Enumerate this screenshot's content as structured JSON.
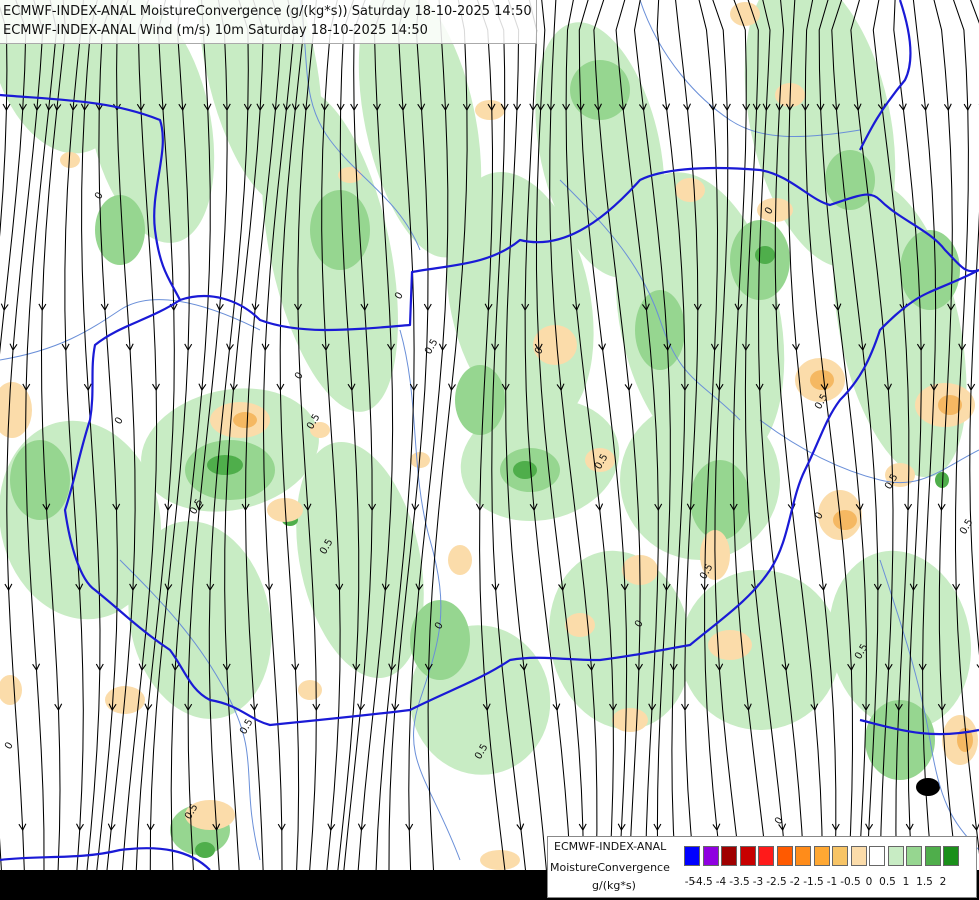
{
  "titles": {
    "line1": "ECMWF-INDEX-ANAL MoistureConvergence (g/(kg*s)) Saturday 18-10-2025 14:50",
    "line2": "ECMWF-INDEX-ANAL Wind (m/s) 10m Saturday 18-10-2025 14:50"
  },
  "colors": {
    "border": "#1a1ad6",
    "river": "#6a8fd8",
    "streamline": "#000000",
    "green_light": "#c8ecc4",
    "green_mid": "#96d690",
    "green_dark": "#4fae4b",
    "orange_light": "#fbdcaa",
    "orange_mid": "#f5b862",
    "dark_spot": "#000000"
  },
  "contour_labels": [
    "0",
    "0.5",
    "0",
    "0.5",
    "0",
    "0.5",
    "0",
    "0.5",
    "0.5",
    "0",
    "0.5",
    "0",
    "0.5",
    "0.5",
    "0",
    "0.5",
    "0.5",
    "0",
    "0.5",
    "0",
    "0.5",
    "0",
    "0.5",
    "0"
  ],
  "legend": {
    "title_line1": "ECMWF-INDEX-ANAL",
    "title_line2": "MoistureConvergence",
    "title_line3": "g/(kg*s)",
    "ticks": [
      "-5",
      "-4.5",
      "-4",
      "-3.5",
      "-3",
      "-2.5",
      "-2",
      "-1.5",
      "-1",
      "-0.5",
      "0",
      "0.5",
      "1",
      "1.5",
      "2"
    ],
    "swatches": [
      "#0000ff",
      "#8f00e0",
      "#a00000",
      "#c80000",
      "#ff1a1a",
      "#ff5a00",
      "#ff8c1a",
      "#ffa833",
      "#f7c466",
      "#fbdcaa",
      "#ffffff",
      "#c8ecc4",
      "#96d690",
      "#4fae4b",
      "#1a8f1a"
    ]
  }
}
